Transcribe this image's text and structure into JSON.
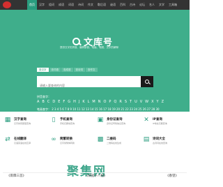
{
  "nav": [
    "首页",
    "汉字",
    "组词",
    "成语",
    "词语",
    "诗词",
    "作文",
    "歇后语",
    "谜语",
    "百科",
    "古诗",
    "论坛",
    "名人",
    "文学",
    "工具箱"
  ],
  "brand": {
    "title": "文库号",
    "slogan": "提供汉字的拼音、偏旁部首、笔画、笔顺、汉字的解释"
  },
  "search": {
    "tabs": [
      "查汉字",
      "查词语",
      "查成语",
      "查诗词",
      "查作文"
    ],
    "placeholder": "请输入要查询的内容"
  },
  "pinyin": {
    "label": "拼音查字：",
    "letters": [
      "A",
      "B",
      "C",
      "D",
      "E",
      "F",
      "G",
      "H",
      "J",
      "K",
      "L",
      "M",
      "N",
      "O",
      "P",
      "Q",
      "R",
      "S",
      "T",
      "U",
      "V",
      "W",
      "X",
      "Y",
      "Z"
    ]
  },
  "strokes": {
    "label": "笔画查字：",
    "numbers": [
      "2",
      "3",
      "4",
      "5",
      "6",
      "7",
      "8",
      "9",
      "10",
      "11",
      "12",
      "13",
      "14",
      "15",
      "16",
      "17",
      "18",
      "19",
      "20",
      "21",
      "22",
      "23",
      "24",
      "25",
      "26",
      "27",
      "28",
      "30"
    ]
  },
  "tools": [
    {
      "title": "汉字查询",
      "desc": "汉字拼音部首查询",
      "icon": "grid-icon"
    },
    {
      "title": "手机查询",
      "desc": "手机归属地查询",
      "icon": "phone-icon"
    },
    {
      "title": "身份证查询",
      "desc": "身份证号码信息查询",
      "icon": "id-card-icon"
    },
    {
      "title": "IP查询",
      "desc": "IP地址归属查询",
      "icon": "tools-icon"
    },
    {
      "title": "在线翻译",
      "desc": "汉语英语在线互译",
      "icon": "translate-icon"
    },
    {
      "title": "简繁转换",
      "desc": "汉字简繁体转换",
      "icon": "link-icon"
    },
    {
      "title": "二维码",
      "desc": "二维码在线生成",
      "icon": "qrcode-icon"
    },
    {
      "title": "诗词大全",
      "desc": "古诗词在线查询",
      "icon": "document-icon"
    }
  ],
  "watermark": "聚集网",
  "poems": [
    "《雨霖三首》",
    "《胡笳十八拍》",
    "《春望》"
  ],
  "colors": {
    "accent": "#3fae8b",
    "nav_bg": "#333333",
    "logo": "#d32f2f"
  }
}
